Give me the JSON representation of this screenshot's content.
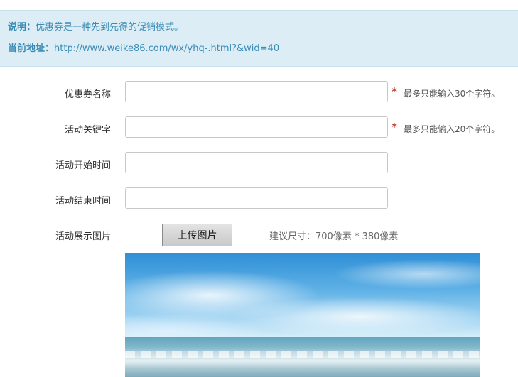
{
  "info": {
    "desc_label": "说明：",
    "desc_text": "优惠券是一种先到先得的促销模式。",
    "addr_label": "当前地址：",
    "addr_text": "http://www.weike86.com/wx/yhq-.html?&wid=40"
  },
  "form": {
    "coupon_name_label": "优惠券名称",
    "coupon_name_value": "",
    "coupon_name_hint": "最多只能输入30个字符。",
    "keyword_label": "活动关键字",
    "keyword_value": "",
    "keyword_hint": "最多只能输入20个字符。",
    "start_time_label": "活动开始时间",
    "start_time_value": "",
    "end_time_label": "活动结束时间",
    "end_time_value": "",
    "image_label": "活动展示图片",
    "upload_button_label": "上传图片",
    "size_hint": "建议尺寸：700像素 * 380像素",
    "required_mark": "*"
  },
  "colors": {
    "info_bg": "#dcedf5",
    "info_text": "#3a8bb5",
    "required": "#c0392b"
  }
}
